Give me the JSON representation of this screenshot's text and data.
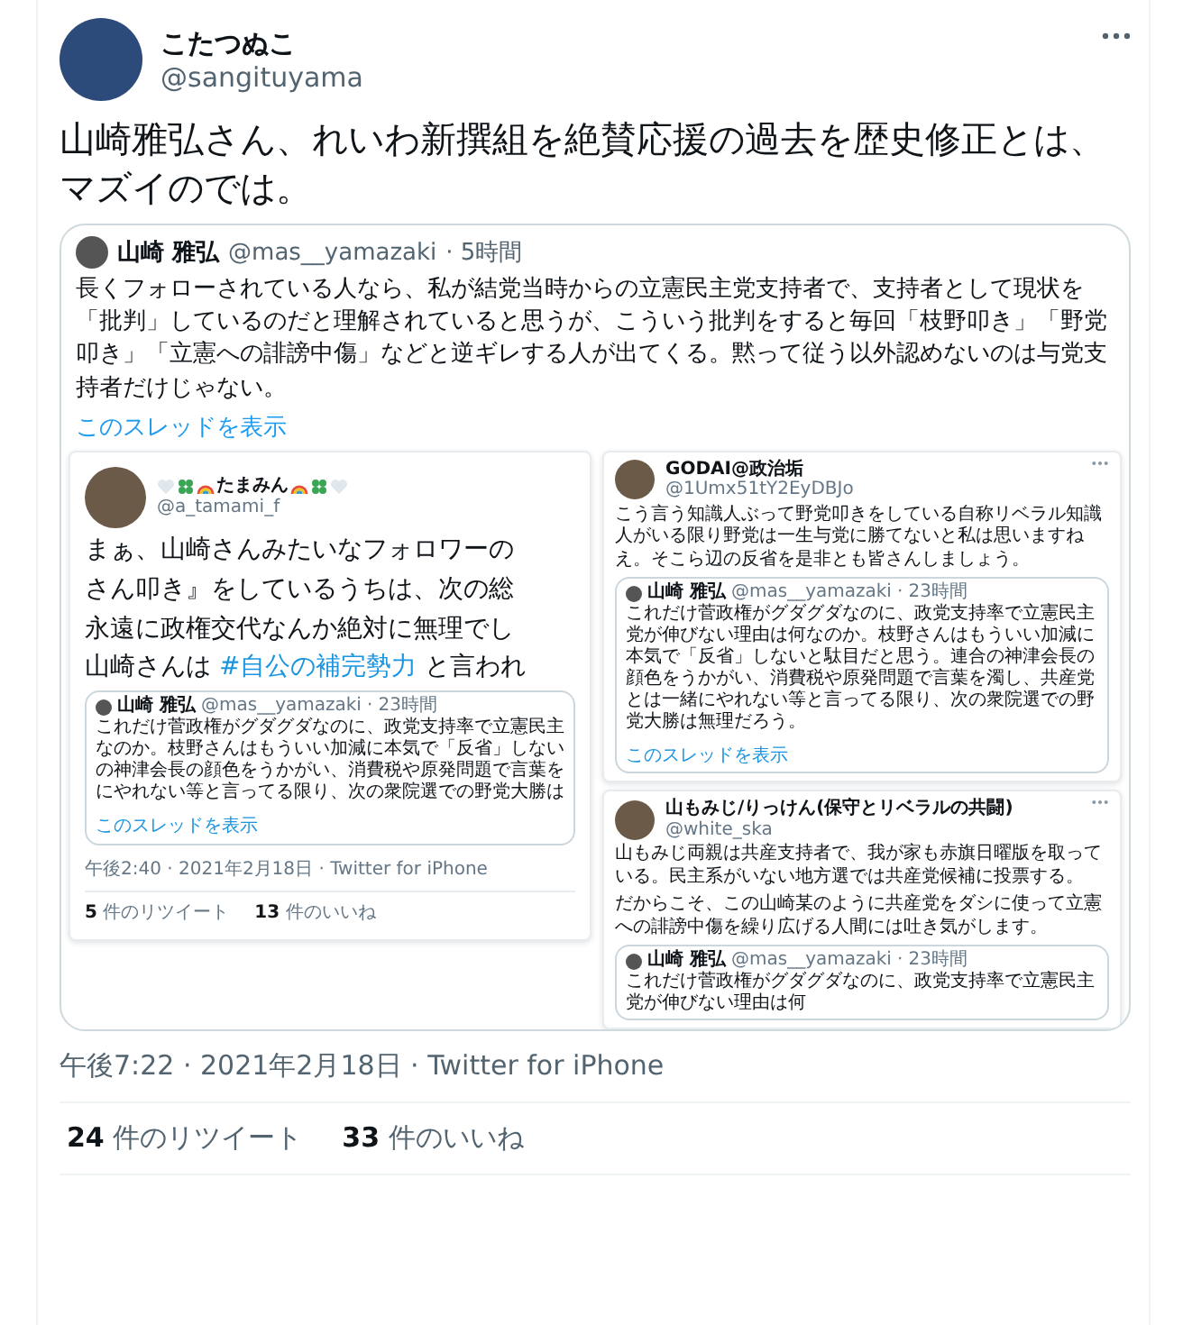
{
  "tweet": {
    "author": {
      "name": "こたつぬこ",
      "handle": "@sangituyama"
    },
    "text": "山崎雅弘さん、れいわ新撰組を絶賛応援の過去を歴史修正とは、マズイのでは。",
    "quoted": {
      "name": "山崎 雅弘",
      "handle": "@mas__yamazaki",
      "time": "· 5時間",
      "text": "長くフォローされている人なら、私が結党当時からの立憲民主党支持者で、支持者として現状を「批判」しているのだと理解されていると思うが、こういう批判をすると毎回「枝野叩き」「野党叩き」「立憲への誹謗中傷」などと逆ギレする人が出てくる。黙って従う以外認めないのは与党支持者だけじゃない。",
      "thread_link": "このスレッドを表示",
      "media": [
        {
          "kind": "cropped",
          "name": "たまみん",
          "handle": "@a_tamami_f",
          "paragraphs": [
            [
              {
                "kind": "text",
                "text": "まぁ、山崎さんみたいなフォロワーの"
              }
            ],
            [
              {
                "kind": "text",
                "text": "さん叩き』をしているうちは、次の総"
              }
            ],
            [
              {
                "kind": "text",
                "text": "永遠に政権交代なんか絶対に無理でし"
              }
            ],
            [
              {
                "kind": "text",
                "text": "山崎さんは "
              },
              {
                "kind": "hashtag",
                "text": "#自公の補完勢力"
              },
              {
                "kind": "text",
                "text": " と言われ"
              }
            ]
          ],
          "quote": {
            "name": "山崎 雅弘",
            "handle": "@mas__yamazaki",
            "time": "· 23時間",
            "lines": [
              "これだけ菅政権がグダグダなのに、政党支持率で立憲民主",
              "なのか。枝野さんはもういい加減に本気で「反省」しない",
              "の神津会長の顔色をうかがい、消費税や原発問題で言葉を",
              "にやれない等と言ってる限り、次の衆院選での野党大勝は"
            ],
            "thread_link": "このスレッドを表示"
          },
          "timestamp": "午後2:40 · 2021年2月18日 · Twitter for iPhone",
          "retweets": {
            "count": "5",
            "label": "件のリツイート"
          },
          "likes": {
            "count": "13",
            "label": "件のいいね"
          }
        },
        {
          "kind": "full",
          "name": "GODAI@政治垢",
          "handle": "@1Umx51tY2EyDBJo",
          "paragraphs": [
            [
              {
                "kind": "text",
                "text": "こう言う知識人ぶって野党叩きをしている自称リベラル知識人がいる限り野党は一生与党に勝てないと私は思いますねえ。そこら辺の反省を是非とも皆さんしましょう。"
              }
            ]
          ],
          "quote": {
            "name": "山崎 雅弘",
            "handle": "@mas__yamazaki",
            "time": "· 23時間",
            "lines": [
              "これだけ菅政権がグダグダなのに、政党支持率で立憲民主党が伸びない理由は何なのか。枝野さんはもういい加減に本気で「反省」しないと駄目だと思う。連合の神津会長の顔色をうかがい、消費税や原発問題で言葉を濁し、共産党とは一緒にやれない等と言ってる限り、次の衆院選での野党大勝は無理だろう。"
            ],
            "thread_link": "このスレッドを表示"
          }
        },
        {
          "kind": "full",
          "name": "山もみじ/りっけん(保守とリベラルの共闘)",
          "handle": "@white_ska",
          "paragraphs": [
            [
              {
                "kind": "text",
                "text": "山もみじ両親は共産支持者で、我が家も赤旗日曜版を取っている。民主系がいない地方選では共産党候補に投票する。"
              }
            ],
            [
              {
                "kind": "text",
                "text": "だからこそ、この山崎某のように共産党をダシに使って立憲への誹謗中傷を繰り広げる人間には吐き気がします。"
              }
            ]
          ],
          "quote": {
            "name": "山崎 雅弘",
            "handle": "@mas__yamazaki",
            "time": "· 23時間",
            "lines": [
              "これだけ菅政権がグダグダなのに、政党支持率で立憲民主党が伸びない理由は何"
            ]
          }
        }
      ]
    },
    "timestamp": "午後7:22 · 2021年2月18日 · Twitter for iPhone",
    "retweets": {
      "count": "24",
      "label": "件のリツイート"
    },
    "likes": {
      "count": "33",
      "label": "件のいいね"
    }
  }
}
